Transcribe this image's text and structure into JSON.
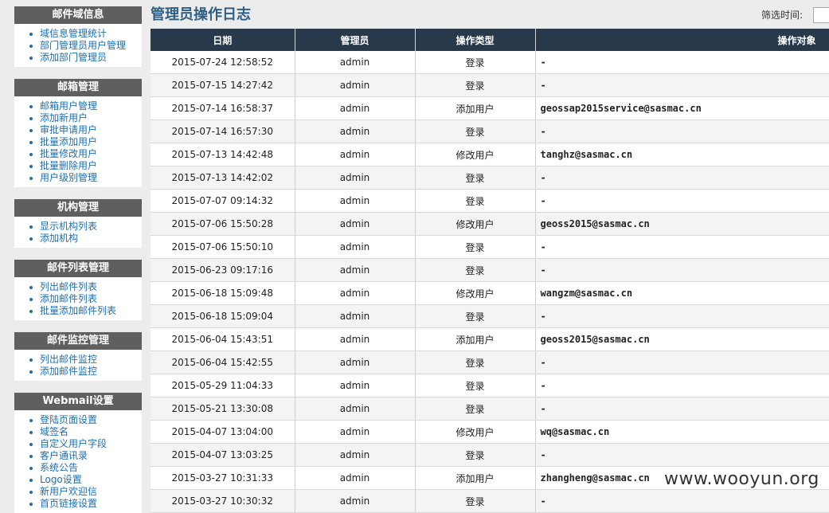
{
  "sidebar": {
    "sections": [
      {
        "title": "邮件域信息",
        "items": [
          "域信息管理统计",
          "部门管理员用户管理",
          "添加部门管理员"
        ]
      },
      {
        "title": "邮箱管理",
        "items": [
          "邮箱用户管理",
          "添加新用户",
          "审批申请用户",
          "批量添加用户",
          "批量修改用户",
          "批量删除用户",
          "用户级别管理"
        ]
      },
      {
        "title": "机构管理",
        "items": [
          "显示机构列表",
          "添加机构"
        ]
      },
      {
        "title": "邮件列表管理",
        "items": [
          "列出邮件列表",
          "添加邮件列表",
          "批量添加邮件列表"
        ]
      },
      {
        "title": "邮件监控管理",
        "items": [
          "列出邮件监控",
          "添加邮件监控"
        ]
      },
      {
        "title": "Webmail设置",
        "items": [
          "登陆页面设置",
          "域签名",
          "自定义用户字段",
          "客户通讯录",
          "系统公告",
          "Logo设置",
          "新用户欢迎信",
          "首页链接设置"
        ]
      }
    ]
  },
  "page": {
    "title": "管理员操作日志",
    "filter_label": "筛选时间:",
    "watermark": "www.wooyun.org"
  },
  "table": {
    "headers": [
      "日期",
      "管理员",
      "操作类型",
      "操作对象"
    ],
    "rows": [
      [
        "2015-07-24 12:58:52",
        "admin",
        "登录",
        "-"
      ],
      [
        "2015-07-15 14:27:42",
        "admin",
        "登录",
        "-"
      ],
      [
        "2015-07-14 16:58:37",
        "admin",
        "添加用户",
        "geossap2015service@sasmac.cn"
      ],
      [
        "2015-07-14 16:57:30",
        "admin",
        "登录",
        "-"
      ],
      [
        "2015-07-13 14:42:48",
        "admin",
        "修改用户",
        "tanghz@sasmac.cn"
      ],
      [
        "2015-07-13 14:42:02",
        "admin",
        "登录",
        "-"
      ],
      [
        "2015-07-07 09:14:32",
        "admin",
        "登录",
        "-"
      ],
      [
        "2015-07-06 15:50:28",
        "admin",
        "修改用户",
        "geoss2015@sasmac.cn"
      ],
      [
        "2015-07-06 15:50:10",
        "admin",
        "登录",
        "-"
      ],
      [
        "2015-06-23 09:17:16",
        "admin",
        "登录",
        "-"
      ],
      [
        "2015-06-18 15:09:48",
        "admin",
        "修改用户",
        "wangzm@sasmac.cn"
      ],
      [
        "2015-06-18 15:09:04",
        "admin",
        "登录",
        "-"
      ],
      [
        "2015-06-04 15:43:51",
        "admin",
        "添加用户",
        "geoss2015@sasmac.cn"
      ],
      [
        "2015-06-04 15:42:55",
        "admin",
        "登录",
        "-"
      ],
      [
        "2015-05-29 11:04:33",
        "admin",
        "登录",
        "-"
      ],
      [
        "2015-05-21 13:30:08",
        "admin",
        "登录",
        "-"
      ],
      [
        "2015-04-07 13:04:00",
        "admin",
        "修改用户",
        "wq@sasmac.cn"
      ],
      [
        "2015-04-07 13:03:25",
        "admin",
        "登录",
        "-"
      ],
      [
        "2015-03-27 10:31:33",
        "admin",
        "添加用户",
        "zhangheng@sasmac.cn"
      ],
      [
        "2015-03-27 10:30:32",
        "admin",
        "登录",
        "-"
      ]
    ]
  }
}
